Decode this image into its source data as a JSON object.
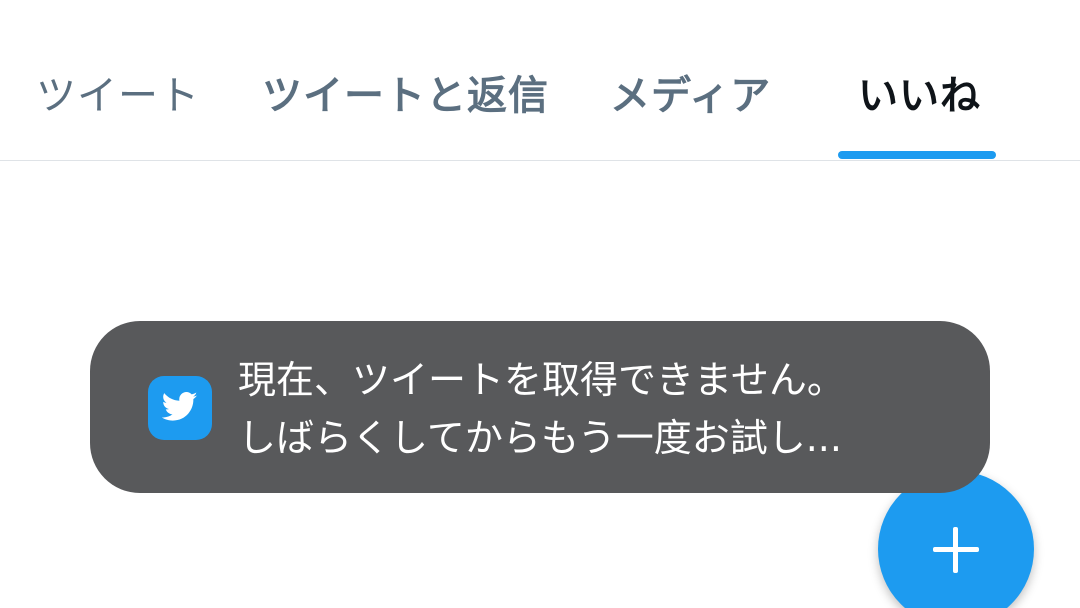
{
  "tabs": [
    {
      "label": "ツイート",
      "active": false
    },
    {
      "label": "ツイートと返信",
      "active": false
    },
    {
      "label": "メディア",
      "active": false
    },
    {
      "label": "いいね",
      "active": true
    }
  ],
  "toast": {
    "line1": "現在、ツイートを取得できません。",
    "line2": "しばらくしてからもう一度お試し...",
    "app_icon": "twitter-bird-icon"
  },
  "fab": {
    "icon": "plus-icon"
  },
  "colors": {
    "accent": "#1d9bf0",
    "tab_inactive": "#5b6f80",
    "tab_active": "#0f1419",
    "toast_bg": "#58595b"
  }
}
